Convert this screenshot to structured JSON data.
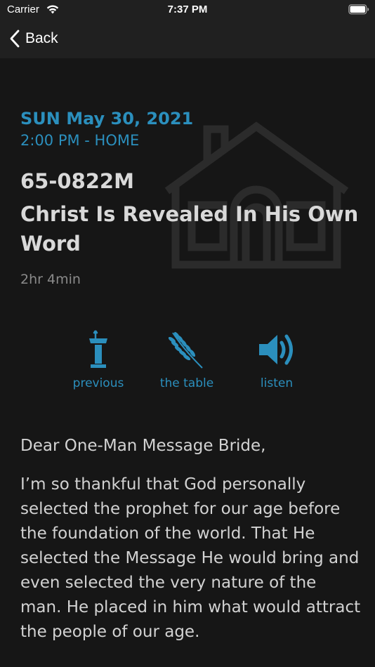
{
  "status_bar": {
    "carrier": "Carrier",
    "time": "7:37 PM"
  },
  "nav": {
    "back_label": "Back"
  },
  "event": {
    "date": "SUN May 30, 2021",
    "time_location": "2:00 PM - HOME",
    "sermon_code": "65-0822M",
    "sermon_title": "Christ Is Revealed In His Own Word",
    "duration": "2hr 4min"
  },
  "actions": {
    "previous": "previous",
    "table": "the table",
    "listen": "listen"
  },
  "letter": {
    "greeting": "Dear One-Man Message Bride,",
    "paragraph": "I’m so thankful that God personally selected the prophet for our age before the foundation of the world. That He selected the Message He would bring and even selected the very nature of the man. He placed in him what would attract the people of our age."
  },
  "colors": {
    "accent": "#2b8fbd",
    "background": "#161616",
    "bar": "#202020"
  }
}
